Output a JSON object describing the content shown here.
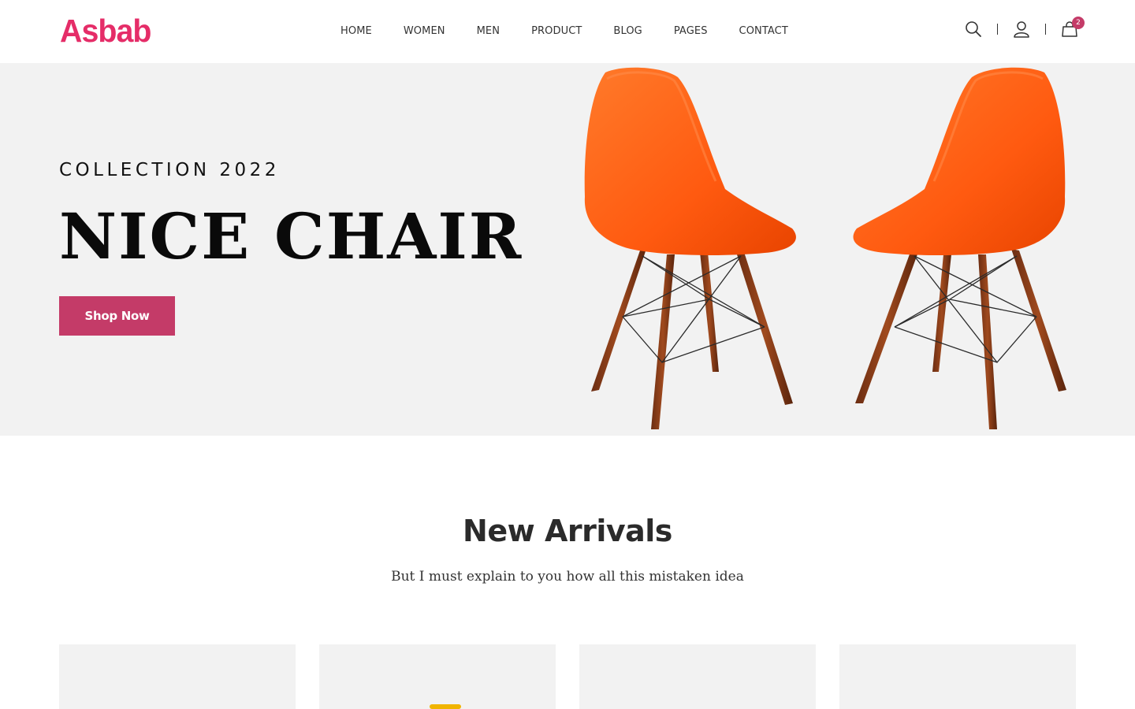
{
  "brand": {
    "logo_text": "Asbab",
    "logo_color": "#e52d68",
    "accent_color": "#c43b68"
  },
  "nav": {
    "items": [
      {
        "label": "HOME"
      },
      {
        "label": "WOMEN"
      },
      {
        "label": "MEN"
      },
      {
        "label": "PRODUCT"
      },
      {
        "label": "BLOG"
      },
      {
        "label": "PAGES"
      },
      {
        "label": "CONTACT"
      }
    ]
  },
  "header_tools": {
    "icons": [
      "search-icon",
      "user-icon",
      "cart-icon"
    ],
    "cart_count": "2"
  },
  "hero": {
    "kicker": "COLLECTION 2022",
    "title": "NICE CHAIR",
    "button_label": "Shop Now",
    "background": "#f2f2f2",
    "chair_color": "#ff5a14"
  },
  "new_arrivals": {
    "title": "New Arrivals",
    "subtitle": "But I must explain to you how all this mistaken idea",
    "cards": [
      {},
      {},
      {},
      {}
    ]
  }
}
